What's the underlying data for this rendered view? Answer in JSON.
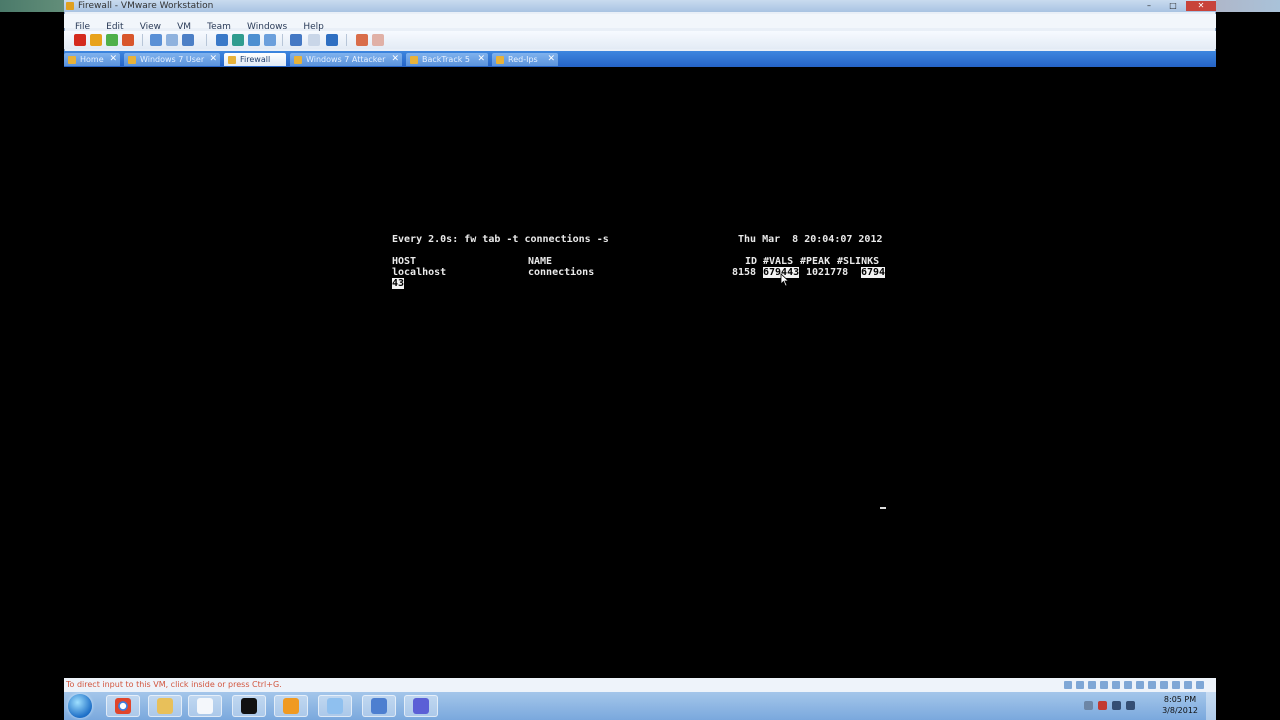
{
  "window": {
    "title": "Firewall - VMware Workstation",
    "controls": {
      "minimize": "–",
      "maximize": "□",
      "close": "✕"
    }
  },
  "menu": [
    "File",
    "Edit",
    "View",
    "VM",
    "Team",
    "Windows",
    "Help"
  ],
  "tabs": [
    {
      "label": "Home",
      "active": false
    },
    {
      "label": "Windows 7 User",
      "active": false
    },
    {
      "label": "Firewall",
      "active": true
    },
    {
      "label": "Windows 7 Attacker",
      "active": false
    },
    {
      "label": "BackTrack 5",
      "active": false
    },
    {
      "label": "Red-Ips",
      "active": false
    }
  ],
  "tab_close": "✕",
  "terminal": {
    "command_line": "Every 2.0s: fw tab -t connections -s",
    "timestamp": "Thu Mar  8 20:04:07 2012",
    "headers": {
      "host": "HOST",
      "name": "NAME",
      "id": "ID",
      "vals": "#VALS",
      "peak": "#PEAK",
      "slinks": "#SLINKS"
    },
    "row": {
      "host": "localhost",
      "name": "connections",
      "id": "8158",
      "vals": "679443",
      "peak": "1021778",
      "slinks_part1": "6794",
      "slinks_part2": "43"
    }
  },
  "status_hint": "To direct input to this VM, click inside or press Ctrl+G.",
  "taskbar": {
    "clock_time": "8:05 PM",
    "clock_date": "3/8/2012"
  },
  "colors": {
    "tab_bar": "#2563c6",
    "terminal_bg": "#000000",
    "terminal_fg": "#eaeaea"
  }
}
